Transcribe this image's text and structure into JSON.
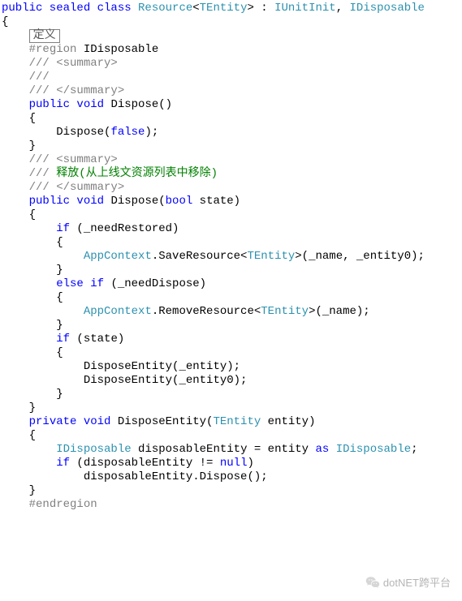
{
  "colors": {
    "keyword": "#0000ff",
    "type": "#2b91af",
    "comment": "#808080",
    "docText": "#008000",
    "region": "#808080"
  },
  "collapsedLabel": "定义",
  "code": {
    "line01_pre": "public sealed class ",
    "line01_type1": "Resource",
    "line01_mid1": "<",
    "line01_type2": "TEntity",
    "line01_mid2": "> : ",
    "line01_type3": "IUnitInit",
    "line01_mid3": ", ",
    "line01_type4": "IDisposable",
    "line02": "{",
    "line03_region": "#region",
    "line03_txt": " IDisposable",
    "line04": "/// <summary>",
    "line05": "///",
    "line06": "/// </summary>",
    "line07_pre": "public void ",
    "line07_post": "Dispose()",
    "line08": "{",
    "line09_pre": "    Dispose(",
    "line09_kw": "false",
    "line09_post": ");",
    "line10": "}",
    "line11": "/// <summary>",
    "line12_pre": "/// ",
    "line12_txt": "释放(从上线文资源列表中移除)",
    "line13": "/// </summary>",
    "line14_pre": "public void ",
    "line14_mid": "Dispose(",
    "line14_kw": "bool",
    "line14_post": " state)",
    "line15": "{",
    "line16_pre": "    ",
    "line16_kw": "if",
    "line16_post": " (_needRestored)",
    "line17": "    {",
    "line18_pre": "        ",
    "line18_type": "AppContext",
    "line18_mid": ".SaveResource<",
    "line18_type2": "TEntity",
    "line18_post": ">(_name, _entity0);",
    "line19": "    }",
    "line20_pre": "    ",
    "line20_kw1": "else",
    "line20_mid": " ",
    "line20_kw2": "if",
    "line20_post": " (_needDispose)",
    "line21": "    {",
    "line22_pre": "        ",
    "line22_type": "AppContext",
    "line22_mid": ".RemoveResource<",
    "line22_type2": "TEntity",
    "line22_post": ">(_name);",
    "line23": "    }",
    "line24_pre": "    ",
    "line24_kw": "if",
    "line24_post": " (state)",
    "line25": "    {",
    "line26": "        DisposeEntity(_entity);",
    "line27": "        DisposeEntity(_entity0);",
    "line28": "    }",
    "line29": "}",
    "line30_pre": "private void ",
    "line30_mid": "DisposeEntity(",
    "line30_type": "TEntity",
    "line30_post": " entity)",
    "line31": "{",
    "line32_pre": "    ",
    "line32_type": "IDisposable",
    "line32_mid": " disposableEntity = entity ",
    "line32_kw": "as",
    "line32_sp": " ",
    "line32_type2": "IDisposable",
    "line32_post": ";",
    "line33_pre": "    ",
    "line33_kw": "if",
    "line33_mid": " (disposableEntity != ",
    "line33_kw2": "null",
    "line33_post": ")",
    "line34": "        disposableEntity.Dispose();",
    "line35": "}",
    "line36": "#endregion"
  },
  "watermark": "dotNET跨平台"
}
